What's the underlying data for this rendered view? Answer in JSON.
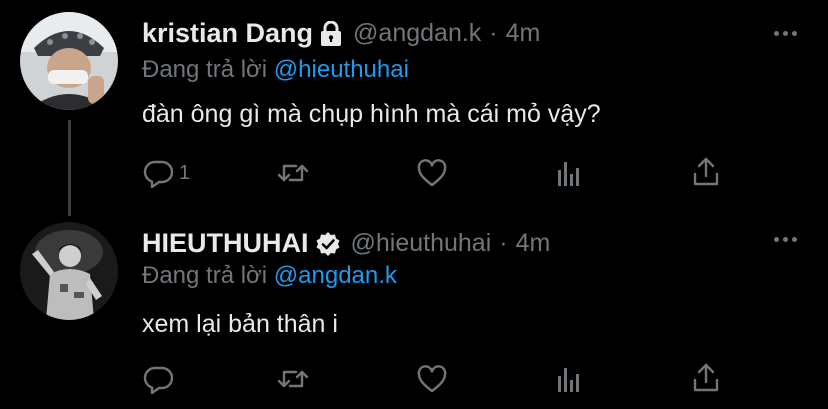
{
  "tweets": [
    {
      "name": "kristian Dang",
      "handle": "@angdan.k",
      "time": "4m",
      "protected_icon": "lock-icon",
      "reply_prefix": "Đang trả lời",
      "reply_to": "@hieuthuhai",
      "text": "đàn ông gì mà chụp hình mà cái mỏ vậy?",
      "reply_count": "1",
      "avatar": "person-with-hat-selfie"
    },
    {
      "name": "HIEUTHUHAI",
      "handle": "@hieuthuhai",
      "time": "4m",
      "verified_icon": "verified-badge-icon",
      "reply_prefix": "Đang trả lời",
      "reply_to": "@angdan.k",
      "text": "xem lại bản thân i",
      "reply_count": "",
      "avatar": "performer-silhouette"
    }
  ],
  "separator": "·",
  "actions": [
    "reply-icon",
    "retweet-icon",
    "like-icon",
    "analytics-icon",
    "share-icon"
  ],
  "colors": {
    "background": "#000000",
    "text": "#e7e9ea",
    "muted": "#71767b",
    "link": "#1d9bf0"
  }
}
